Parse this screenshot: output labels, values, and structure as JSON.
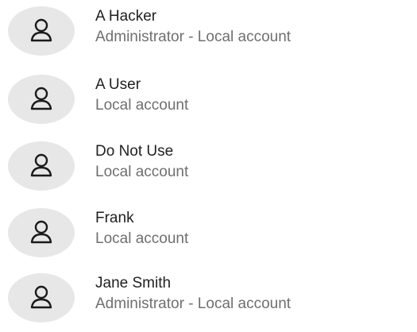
{
  "accounts": [
    {
      "name": "A Hacker",
      "subtitle": "Administrator - Local account",
      "icon": "person-icon"
    },
    {
      "name": "A User",
      "subtitle": "Local account",
      "icon": "person-icon"
    },
    {
      "name": "Do Not Use",
      "subtitle": "Local account",
      "icon": "person-icon"
    },
    {
      "name": "Frank",
      "subtitle": "Local account",
      "icon": "person-icon"
    },
    {
      "name": "Jane Smith",
      "subtitle": "Administrator - Local account",
      "icon": "person-icon"
    }
  ],
  "colors": {
    "avatar_background": "#e7e7e7",
    "name_text": "#1f1f1f",
    "subtitle_text": "#6f6f6f",
    "icon_stroke": "#1a1a1a"
  }
}
